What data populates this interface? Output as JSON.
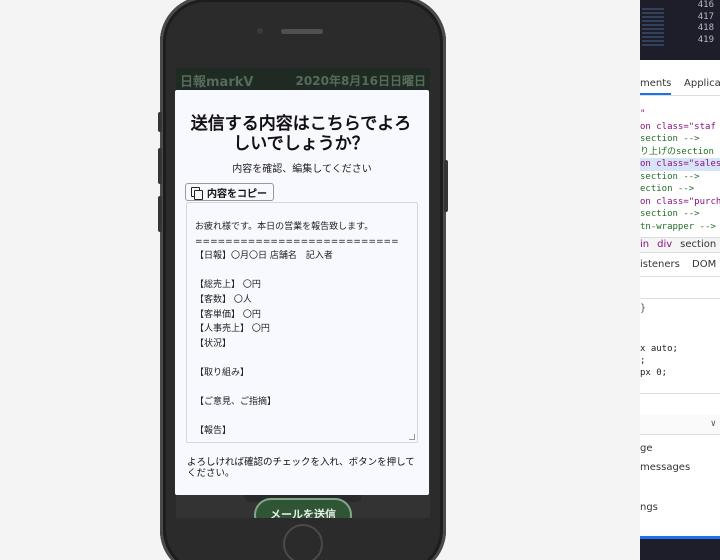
{
  "app": {
    "title": "日報markV",
    "date": "2020年8月16日日曜日",
    "send_button": "メールを送信"
  },
  "modal": {
    "title": "送信する内容はこちらでよろしいでしょうか？",
    "subtitle": "内容を確認、編集してください",
    "copy_button": "内容をコピー",
    "report_lines": [
      "お疲れ様です。本日の営業を報告致します。",
      "===========================",
      "【日報】〇月〇日 店舗名　記入者",
      "",
      "【総売上】 〇円",
      "【客数】 〇人",
      "【客単価】 〇円",
      "【人事売上】 〇円",
      "【状況】",
      "",
      "【取り組み】",
      "",
      "【ご意見、ご指摘】",
      "",
      "【報告】"
    ],
    "footer_text": "よろしければ確認のチェックを入れ、ボタンを押してください。"
  },
  "devtools": {
    "line_numbers": [
      "416",
      "417",
      "418",
      "419"
    ],
    "tabs": [
      "ments",
      "Applicat"
    ],
    "dom_lines": [
      {
        "text": "\"",
        "cls": "k-purple"
      },
      {
        "text": "on class=\"staf",
        "cls": "k-purple"
      },
      {
        "text": "section -->",
        "cls": "k-green"
      },
      {
        "text": "り上げのsection",
        "cls": "k-green"
      },
      {
        "text": "on class=\"sales",
        "cls": "k-purple hl"
      },
      {
        "text": "section -->",
        "cls": "k-green"
      },
      {
        "text": "ection -->",
        "cls": "k-green"
      },
      {
        "text": "on class=\"purch",
        "cls": "k-purple"
      },
      {
        "text": "section -->",
        "cls": "k-green"
      },
      {
        "text": "tn-wrapper -->",
        "cls": "k-green"
      }
    ],
    "breadcrumbs": [
      "in",
      "div",
      "section"
    ],
    "subtabs": [
      "isteners",
      "DOM B"
    ],
    "styles": [
      "x auto;",
      ";",
      "px 0;"
    ],
    "console_messages": [
      "ge",
      "messages",
      "ngs"
    ],
    "chevron": "∨"
  },
  "colors": {
    "accent": "#2f5535",
    "modal_bg": "#f8f8ff"
  }
}
